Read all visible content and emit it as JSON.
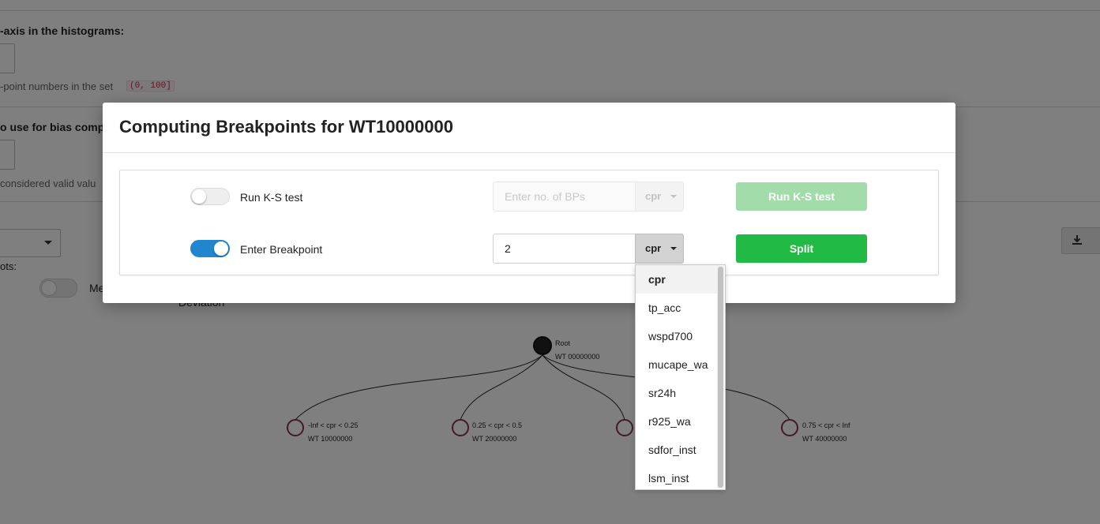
{
  "background": {
    "hist_axis_label": "-axis in the histograms:",
    "float_hint": "-point numbers in the set",
    "float_set": "(0, 100]",
    "bias_label": "o use for bias comput",
    "valid_hint": "considered valid valu",
    "plots_label": "ots:",
    "mini_toggle_label": "Me",
    "deviation_label": "Deviation"
  },
  "tree": {
    "root": {
      "name": "Root",
      "id": "WT 00000000"
    },
    "children": [
      {
        "name": "-Inf < cpr < 0.25",
        "id": "WT 10000000"
      },
      {
        "name": "0.25 < cpr < 0.5",
        "id": "WT 20000000"
      },
      {
        "name": "",
        "id": ""
      },
      {
        "name": "0.75 < cpr < Inf",
        "id": "WT 40000000"
      }
    ]
  },
  "modal": {
    "title": "Computing Breakpoints for WT10000000",
    "ks_row": {
      "toggle_on": false,
      "label": "Run K-S test",
      "input_placeholder": "Enter no. of BPs",
      "input_value": "",
      "predictor": "cpr",
      "button_label": "Run K-S test"
    },
    "bp_row": {
      "toggle_on": true,
      "label": "Enter Breakpoint",
      "input_value": "2",
      "predictor": "cpr",
      "button_label": "Split"
    }
  },
  "dropdown": {
    "selected": "cpr",
    "options": [
      "cpr",
      "tp_acc",
      "wspd700",
      "mucape_wa",
      "sr24h",
      "r925_wa",
      "sdfor_inst",
      "lsm_inst"
    ]
  },
  "colors": {
    "toggle_on": "#2185d0",
    "primary_button": "#21ba45",
    "disabled_button": "#a3dcab"
  },
  "icons": {
    "download": "download-icon",
    "caret": "caret-down-icon"
  }
}
